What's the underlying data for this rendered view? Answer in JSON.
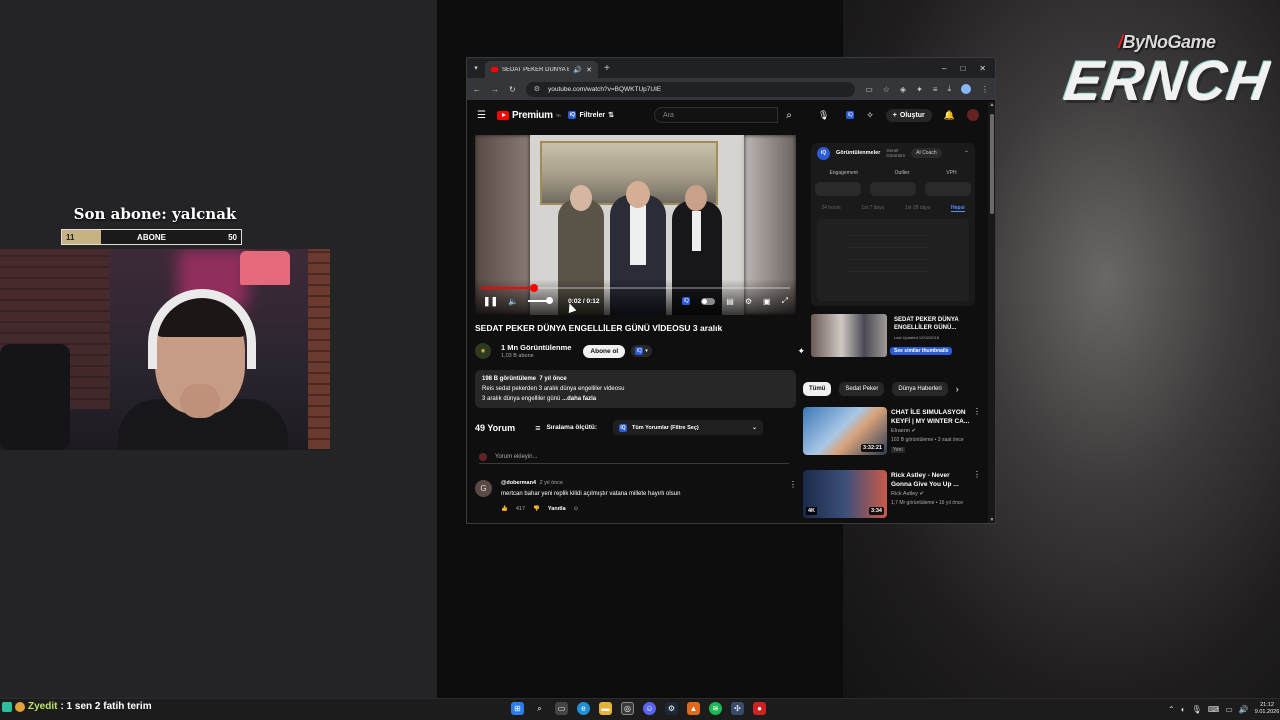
{
  "overlay": {
    "sub_title": "Son abone: yalcnak",
    "sub_current": "11",
    "sub_label": "ABONE",
    "sub_goal": "50",
    "sub_progress": 0.22,
    "logo_top": "ByNoGame",
    "logo_main": "ERNCH"
  },
  "browser": {
    "tab_title": "SEDAT PEKER DÜNYA ENGEL",
    "new_tab": "+",
    "url": "youtube.com/watch?v=BQWKTUp7UIE",
    "win_min": "–",
    "win_max": "□",
    "win_close": "✕"
  },
  "youtube": {
    "logo": "Premium",
    "logo_sup": "TR",
    "filter_label": "Filtreler",
    "search_placeholder": "Ara",
    "create_label": "Oluştur",
    "video_title": "SEDAT PEKER DÜNYA ENGELLİLER GÜNÜ VİDEOSU 3 aralık",
    "time_current": "0:02",
    "time_total": "0:12",
    "timecode": "0:02 / 0:12",
    "progress": 0.17,
    "channel_name": "1 Mn Görüntülenme",
    "channel_subs": "1,03 B abone",
    "subscribe_label": "Abone ol",
    "desc_views": "198 B görüntüleme",
    "desc_ago": "7 yıl önce",
    "desc_line1": "Reis sedat pekerden 3 aralık dünya engelliler videosu",
    "desc_line2": "3 aralık dünya engelliler günü",
    "desc_more": "...daha fazla",
    "comment_count": "49 Yorum",
    "sort_label": "Sıralama ölçütü:",
    "comment_filter": "Tüm Yorumlar (Filtre Seç)",
    "add_comment": "Yorum ekleyin...",
    "comment": {
      "avatar": "G",
      "author": "@doberman4",
      "ago": "2 yıl önce",
      "text": "mertcan bahar yeni replik kilidi açılmıştır vatana millete hayırlı olsun",
      "likes": "417",
      "reply": "Yanıtla"
    }
  },
  "extension": {
    "tab_active": "Görüntülenmeler",
    "tab_general_1": "Genel",
    "tab_general_2": "Görünüm",
    "coach": "AI Coach",
    "metrics": [
      "Engagement",
      "Outlier",
      "VPH"
    ],
    "ranges": [
      "24 hours",
      "1st 7 days",
      "1st 28 days",
      "Hepsi"
    ],
    "thumb_title": "SEDAT PEKER DÜNYA ENGELLİLER GÜNÜ...",
    "thumb_date": "Last Updated 12/02/2018",
    "thumb_btn": "See similar thumbnails"
  },
  "recommendations": {
    "chips": [
      "Tümü",
      "Sedat Peker",
      "Dünya Haberleri"
    ],
    "items": [
      {
        "title": "CHAT İLE SIMULASYON KEYFİ | MY WINTER CA...",
        "channel": "Elraenn",
        "meta": "102 B görüntüleme • 3 saat önce",
        "badge": "Yeni",
        "duration": "3:32:21"
      },
      {
        "title": "Rick Astley - Never Gonna Give You Up ...",
        "channel": "Rick Astley",
        "meta": "1,7 Mr görüntüleme • 16 yıl önce",
        "badge": "4K",
        "duration": "3:34"
      }
    ]
  },
  "taskbar": {
    "chat_user": "Zyedit",
    "chat_text": ": 1 sen 2 fatih terim",
    "time": "21:12",
    "date": "9.01.2026"
  }
}
